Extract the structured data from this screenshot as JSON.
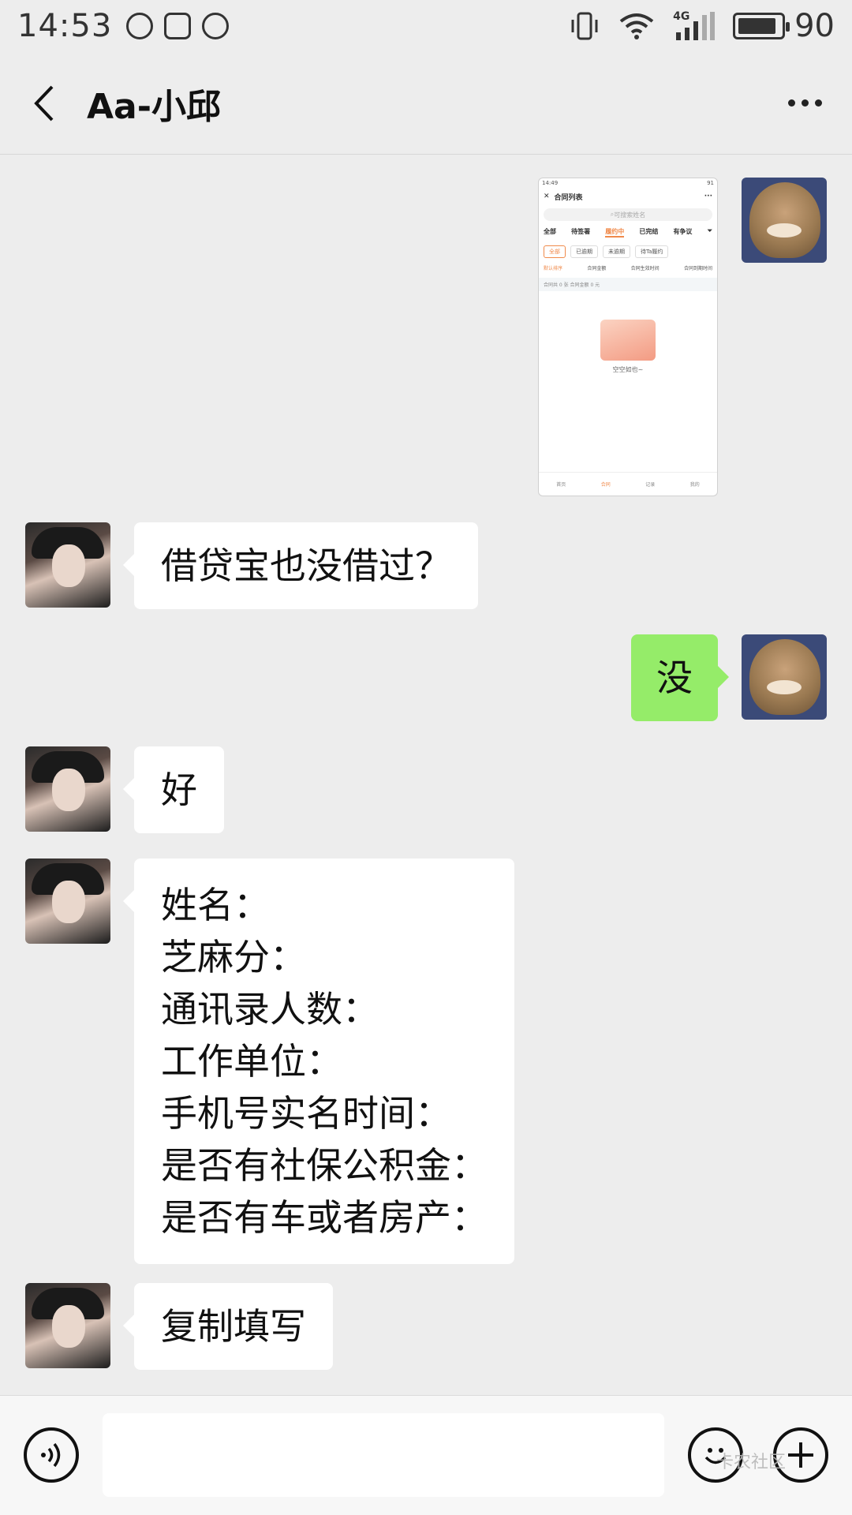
{
  "status_bar": {
    "time": "14:53",
    "network": "4G",
    "battery": "90",
    "battery_level": 0.9,
    "left_icons": [
      "alarm-icon",
      "video-app-icon",
      "weibo-icon"
    ],
    "right_icons": [
      "vibrate-icon",
      "wifi-icon",
      "signal-icon",
      "battery-icon"
    ]
  },
  "nav": {
    "title": "Aa-小邱",
    "back_icon": "back-arrow-icon",
    "more_icon": "more-icon"
  },
  "colors": {
    "background": "#ededed",
    "bubble_in": "#ffffff",
    "bubble_out": "#95ec69",
    "accent": "#f08a4b"
  },
  "messages": [
    {
      "from": "me",
      "type": "image",
      "caption": "screenshot"
    },
    {
      "from": "other",
      "type": "text",
      "text": "借贷宝也没借过？"
    },
    {
      "from": "me",
      "type": "text",
      "text": "没"
    },
    {
      "from": "other",
      "type": "text",
      "text": "好"
    },
    {
      "from": "other",
      "type": "text",
      "text": "姓名：\n芝麻分：\n通讯录人数：\n工作单位：\n手机号实名时间：\n是否有社保公积金：\n是否有车或者房产："
    },
    {
      "from": "other",
      "type": "text",
      "text": "复制填写"
    }
  ],
  "thumbnail": {
    "time": "14:49",
    "battery": "91",
    "title": "合同列表",
    "search_placeholder": "可搜索姓名",
    "tabs": [
      "全部",
      "待签署",
      "履约中",
      "已完结",
      "有争议"
    ],
    "active_tab": "履约中",
    "filters": [
      "全部",
      "已逾期",
      "未逾期",
      "待Ta履约"
    ],
    "active_filter": "全部",
    "sort_options": [
      "默认排序",
      "合同金额",
      "合同生效时间",
      "合同到期时间"
    ],
    "summary": "合同共 0 张  合同金额 0 元",
    "empty_text": "空空如也~",
    "bottom_tabs": [
      "首页",
      "合同",
      "记录",
      "我的"
    ],
    "active_bottom_tab": "合同"
  },
  "input_bar": {
    "voice_icon": "voice-icon",
    "emoji_icon": "emoji-icon",
    "plus_icon": "plus-icon",
    "watermark": "卡农社区"
  }
}
